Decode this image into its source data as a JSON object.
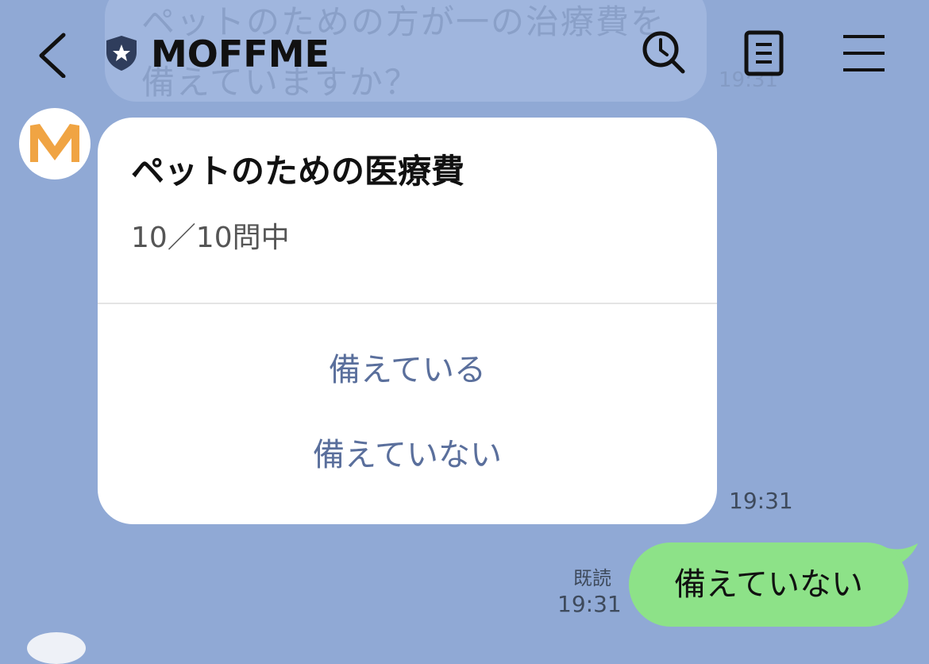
{
  "background_message": {
    "text": "ペットのための方が一の治療費を備えていますか？",
    "time": "19:31"
  },
  "header": {
    "title": "MOFFME",
    "icons": [
      "back-icon",
      "shield-star-icon",
      "search-clock-icon",
      "notes-icon",
      "menu-icon"
    ]
  },
  "card": {
    "title": "ペットのための医療費",
    "subtitle": "10／10問中",
    "options": [
      {
        "label": "備えている"
      },
      {
        "label": "備えていない"
      }
    ],
    "time": "19:31"
  },
  "reply": {
    "read_label": "既読",
    "time": "19:31",
    "text": "備えていない"
  },
  "colors": {
    "background": "#90a9d5",
    "user_bubble": "#8de288",
    "option_text": "#5a6f9c",
    "avatar_orange": "#f0a443"
  }
}
